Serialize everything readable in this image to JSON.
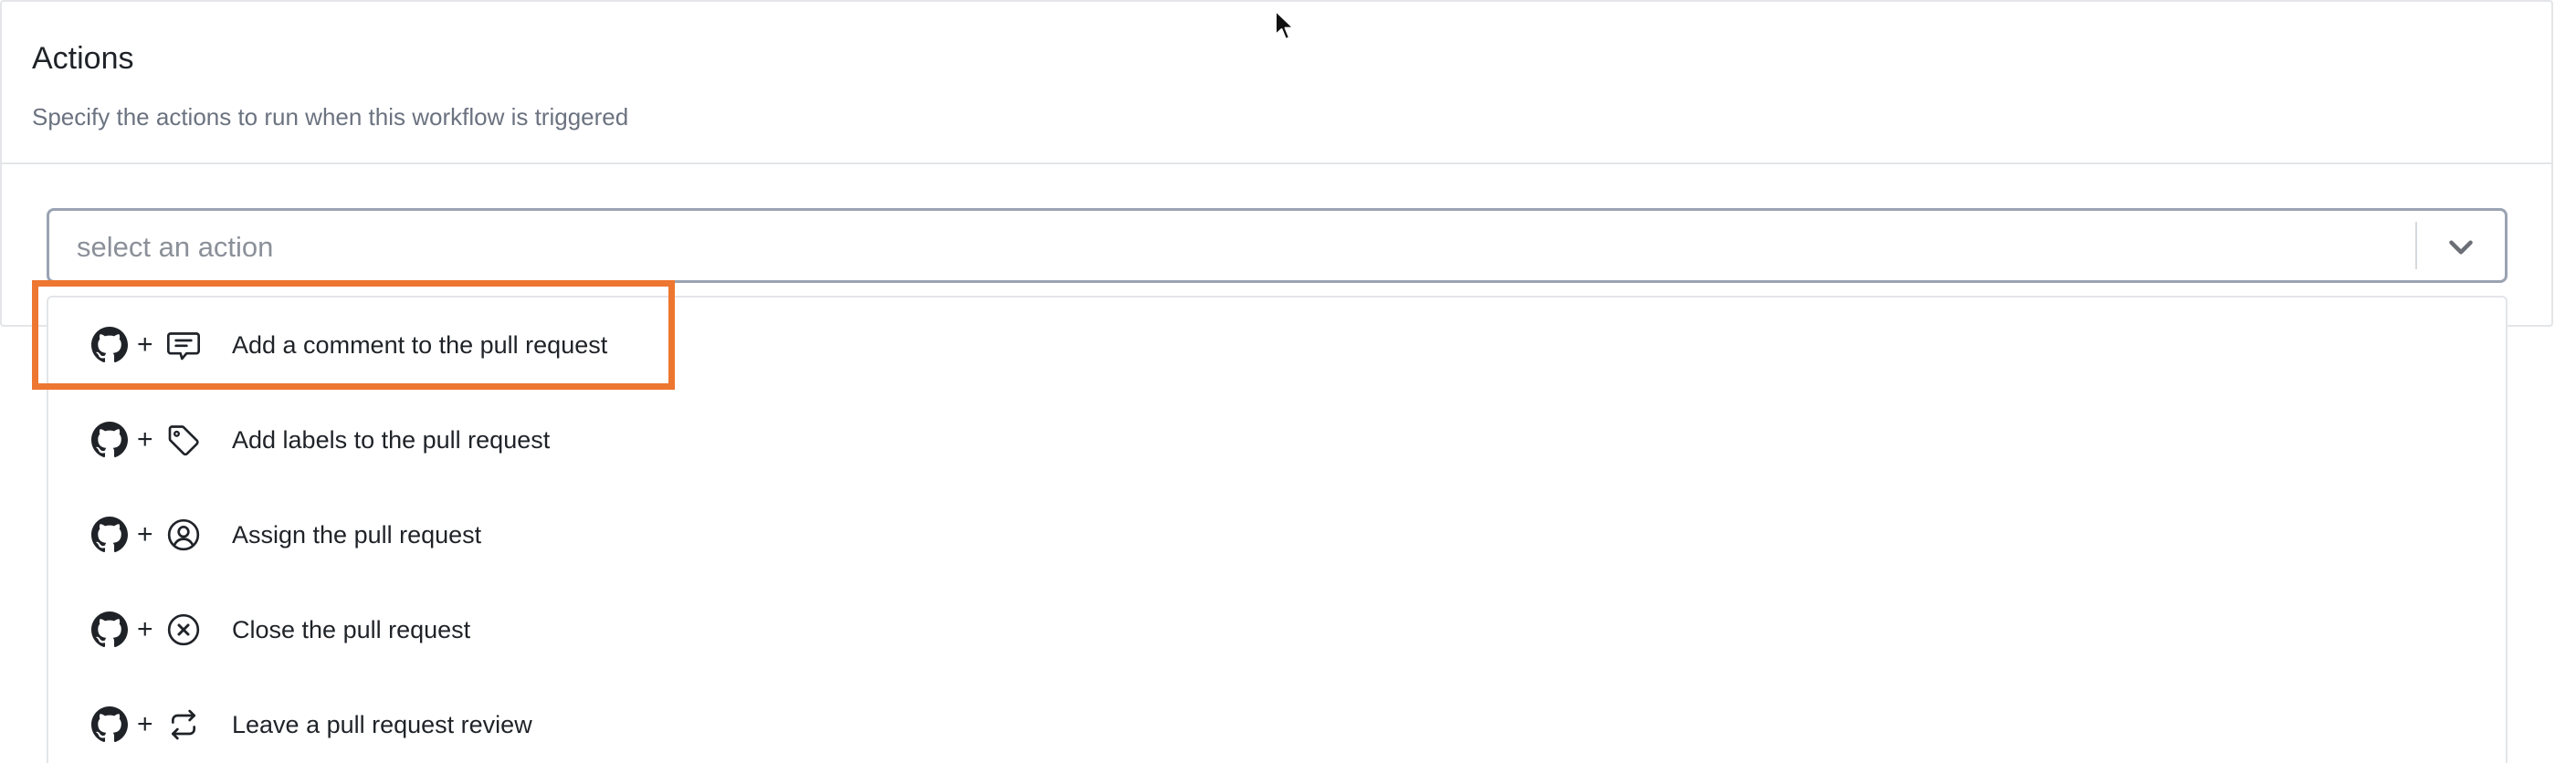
{
  "panel": {
    "title": "Actions",
    "subtitle": "Specify the actions to run when this workflow is triggered"
  },
  "select": {
    "placeholder": "select an action",
    "chevron_icon": "chevron-down-icon"
  },
  "options": [
    {
      "label": "Add a comment to the pull request",
      "service_icon": "github-icon",
      "action_icon": "comment-icon",
      "plus": "+"
    },
    {
      "label": "Add labels to the pull request",
      "service_icon": "github-icon",
      "action_icon": "tag-icon",
      "plus": "+"
    },
    {
      "label": "Assign the pull request",
      "service_icon": "github-icon",
      "action_icon": "user-circle-icon",
      "plus": "+"
    },
    {
      "label": "Close the pull request",
      "service_icon": "github-icon",
      "action_icon": "close-circle-icon",
      "plus": "+"
    },
    {
      "label": "Leave a pull request review",
      "service_icon": "github-icon",
      "action_icon": "refresh-icon",
      "plus": "+"
    }
  ],
  "highlight": {
    "target": "Add a comment to the pull request",
    "color": "#ed7631"
  },
  "colors": {
    "border": "#e3e5e8",
    "select_border": "#9aa3b2",
    "text": "#1f2328",
    "muted": "#6b7280"
  }
}
